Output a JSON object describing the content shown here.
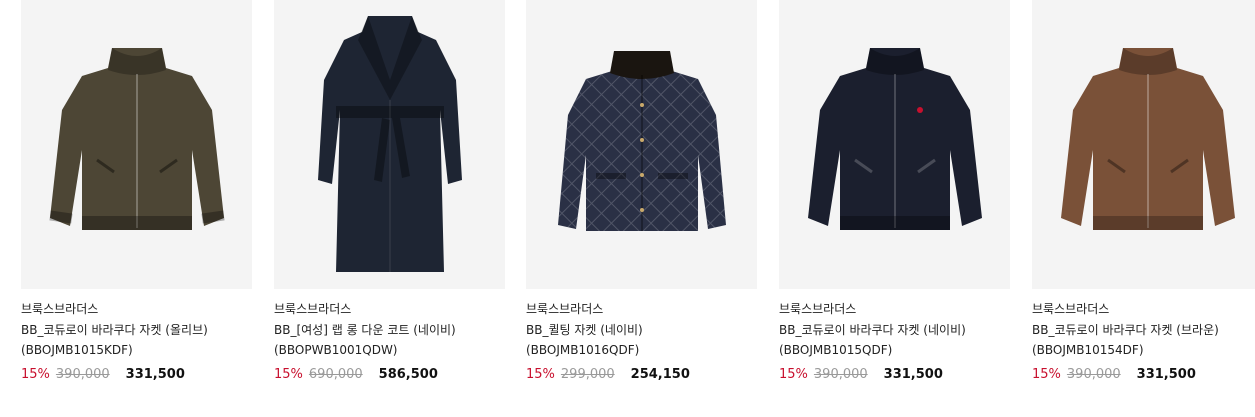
{
  "products": [
    {
      "brand": "브룩스브라더스",
      "name": "BB_코듀로이 바라쿠다 자켓 (올리브)",
      "code": "(BBOJMB1015KDF)",
      "discount": "15%",
      "original_price": "390,000",
      "sale_price": "331,500",
      "image_icon": "olive-corduroy-jacket-icon",
      "color": "#4d4635"
    },
    {
      "brand": "브룩스브라더스",
      "name": "BB_[여성] 랩 롱 다운 코트 (네이비)",
      "code": "(BBOPWB1001QDW)",
      "discount": "15%",
      "original_price": "690,000",
      "sale_price": "586,500",
      "image_icon": "navy-long-down-coat-icon",
      "color": "#1e2533"
    },
    {
      "brand": "브룩스브라더스",
      "name": "BB_퀼팅 자켓 (네이비)",
      "code": "(BBOJMB1016QDF)",
      "discount": "15%",
      "original_price": "299,000",
      "sale_price": "254,150",
      "image_icon": "navy-quilted-jacket-icon",
      "color": "#2a3045"
    },
    {
      "brand": "브룩스브라더스",
      "name": "BB_코듀로이 바라쿠다 자켓 (네이비)",
      "code": "(BBOJMB1015QDF)",
      "discount": "15%",
      "original_price": "390,000",
      "sale_price": "331,500",
      "image_icon": "navy-corduroy-jacket-icon",
      "color": "#1b1f2e"
    },
    {
      "brand": "브룩스브라더스",
      "name": "BB_코듀로이 바라쿠다 자켓 (브라운)",
      "code": "(BBOJMB10154DF)",
      "discount": "15%",
      "original_price": "390,000",
      "sale_price": "331,500",
      "image_icon": "brown-corduroy-jacket-icon",
      "color": "#7a5138"
    }
  ]
}
